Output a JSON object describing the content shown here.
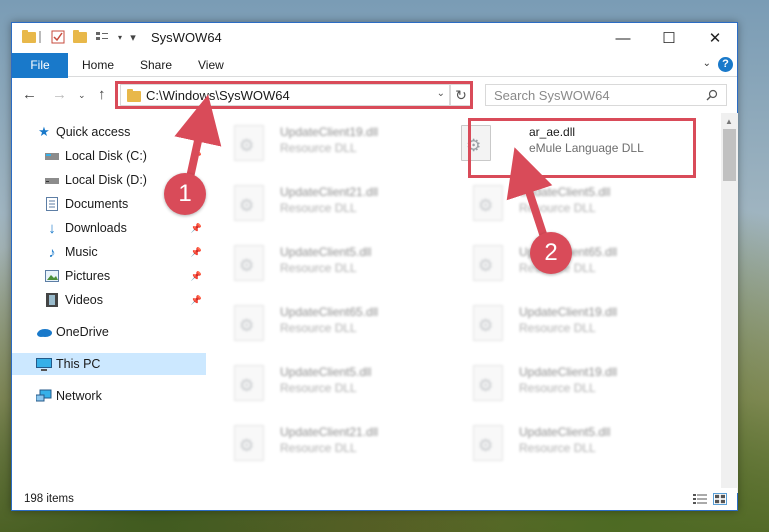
{
  "window": {
    "title": "SysWOW64",
    "minimize_glyph": "—",
    "maximize_glyph": "☐",
    "close_glyph": "✕"
  },
  "ribbon": {
    "tabs": [
      "File",
      "Home",
      "Share",
      "View"
    ],
    "help_label": "?"
  },
  "nav": {
    "address": "C:\\Windows\\SysWOW64",
    "search_placeholder": "Search SysWOW64"
  },
  "sidebar": {
    "items": [
      {
        "label": "Quick access",
        "icon": "star-icon"
      },
      {
        "label": "Local Disk (C:)",
        "icon": "drive-icon"
      },
      {
        "label": "Local Disk (D:)",
        "icon": "drive-icon"
      },
      {
        "label": "Documents",
        "icon": "documents-icon"
      },
      {
        "label": "Downloads",
        "icon": "download-icon"
      },
      {
        "label": "Music",
        "icon": "music-icon"
      },
      {
        "label": "Pictures",
        "icon": "pictures-icon"
      },
      {
        "label": "Videos",
        "icon": "videos-icon"
      },
      {
        "label": "OneDrive",
        "icon": "cloud-icon"
      },
      {
        "label": "This PC",
        "icon": "computer-icon",
        "selected": true
      },
      {
        "label": "Network",
        "icon": "network-icon"
      }
    ]
  },
  "files": {
    "highlighted": {
      "name": "ar_ae.dll",
      "type": "eMule Language DLL"
    },
    "left_column": [
      {
        "name": "UpdateClient19.dll",
        "type": "Resource DLL"
      },
      {
        "name": "UpdateClient21.dll",
        "type": "Resource DLL"
      },
      {
        "name": "UpdateClient5.dll",
        "type": "Resource DLL"
      },
      {
        "name": "UpdateClient65.dll",
        "type": "Resource DLL"
      },
      {
        "name": "UpdateClient5.dll",
        "type": "Resource DLL"
      },
      {
        "name": "UpdateClient21.dll",
        "type": "Resource DLL"
      }
    ],
    "right_column": [
      {
        "name": "UpdateClient5.dll",
        "type": "Resource DLL"
      },
      {
        "name": "UpdateClient65.dll",
        "type": "Resource DLL"
      },
      {
        "name": "UpdateClient19.dll",
        "type": "Resource DLL"
      },
      {
        "name": "UpdateClient19.dll",
        "type": "Resource DLL"
      },
      {
        "name": "UpdateClient5.dll",
        "type": "Resource DLL"
      }
    ]
  },
  "status": {
    "item_count": "198 items"
  },
  "annotations": {
    "badge_1": "1",
    "badge_2": "2",
    "color": "#d94b59"
  }
}
